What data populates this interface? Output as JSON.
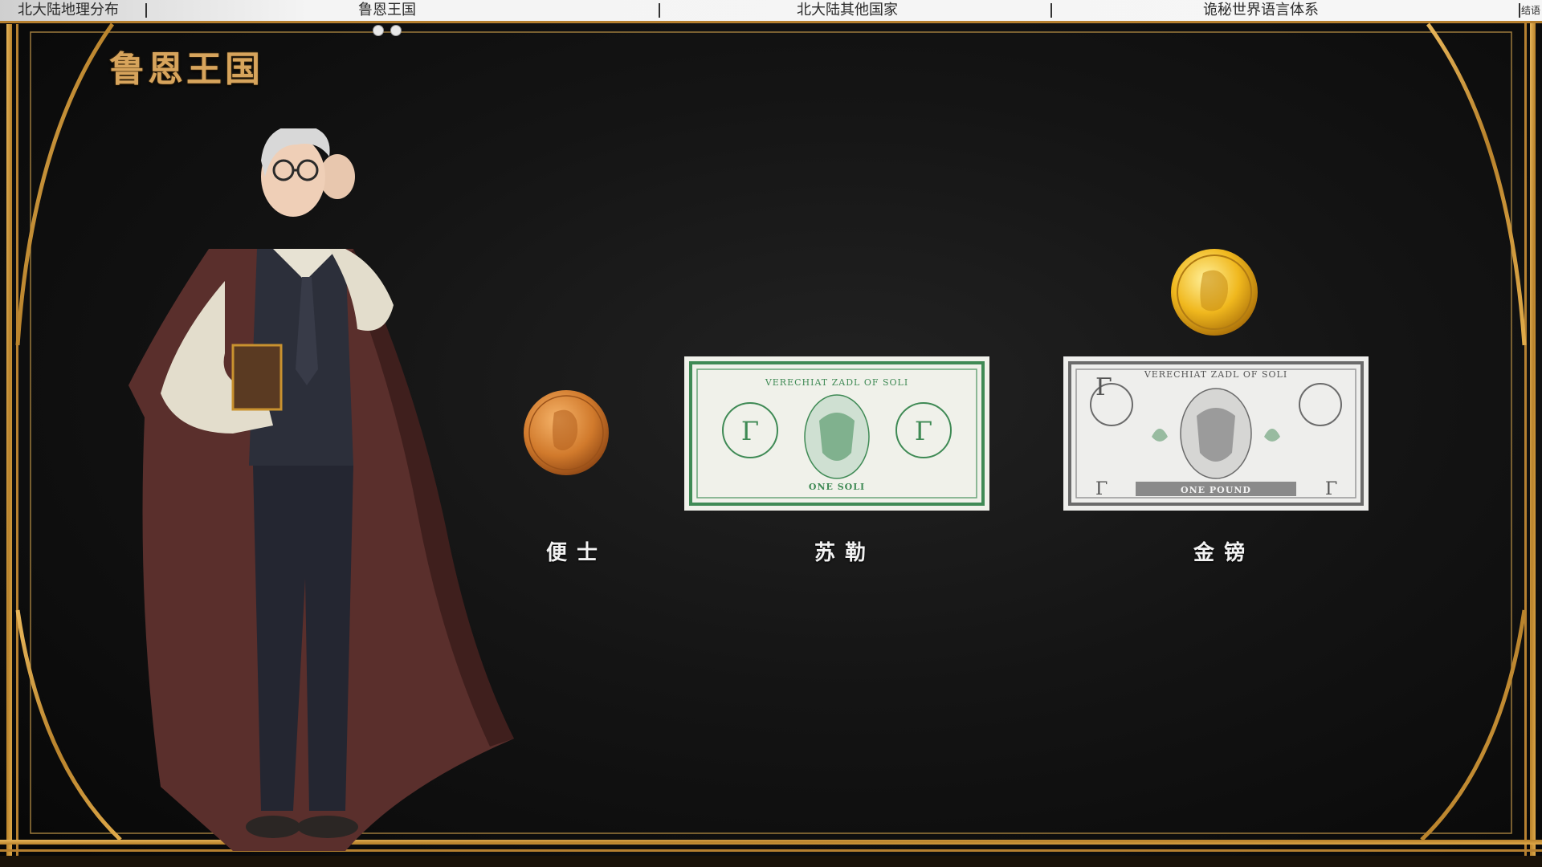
{
  "nav": {
    "items": [
      {
        "label": "北大陆地理分布"
      },
      {
        "label": "鲁恩王国"
      },
      {
        "label": "北大陆其他国家"
      },
      {
        "label": "诡秘世界语言体系"
      },
      {
        "label": "结语"
      }
    ],
    "active_index": 1
  },
  "page": {
    "title": "鲁恩王国"
  },
  "currencies": [
    {
      "label": "便士",
      "icon": "copper-coin-icon"
    },
    {
      "label": "苏勒",
      "icon": "green-banknote-icon"
    },
    {
      "label": "金镑",
      "icon": "gold-coin-and-banknote-icon"
    }
  ],
  "banknotes": {
    "soli": {
      "top_text": "VERECHIAT ZADL OF SOLI",
      "bottom_text": "ONE SOLI",
      "mark": "Γ"
    },
    "pound": {
      "top_text": "VERECHIAT ZADL OF SOLI",
      "bottom_text": "ONE POUND",
      "mark": "Γ"
    }
  },
  "colors": {
    "gold": "#c9922f",
    "title_gold": "#d7a45c",
    "copper": "#d17a2c",
    "banknote_green": "#3f8a55",
    "banknote_gray": "#6b6b6b",
    "background": "#111111"
  }
}
